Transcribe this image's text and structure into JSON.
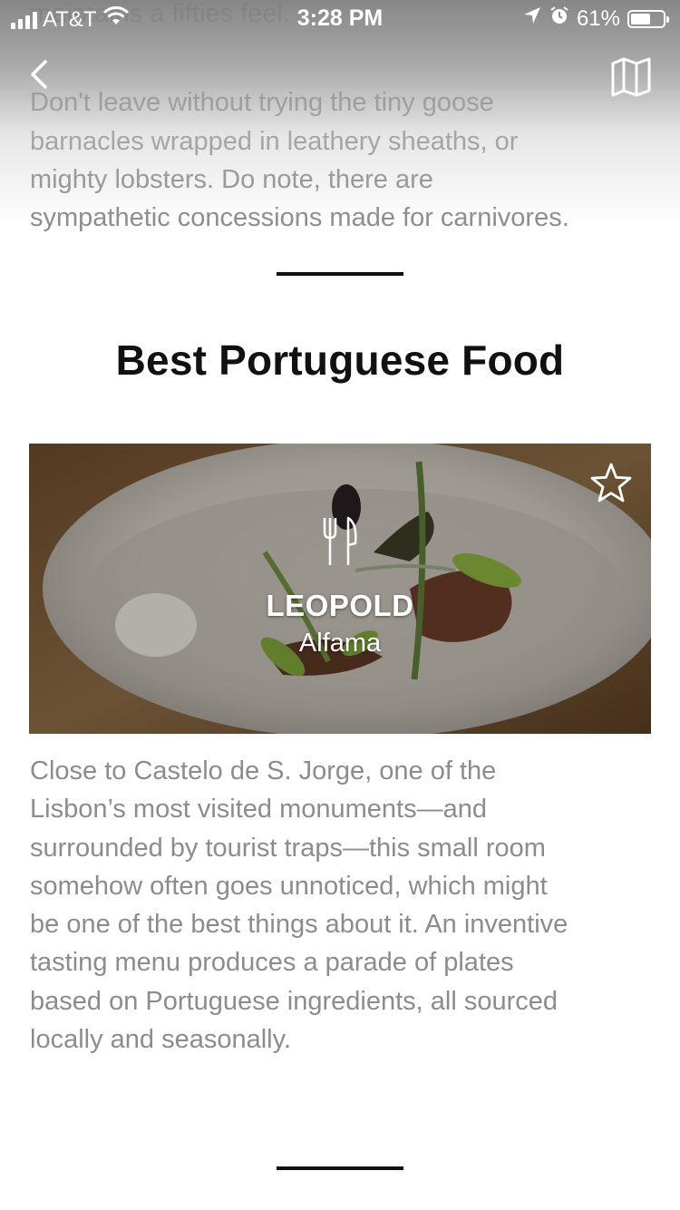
{
  "status_bar": {
    "carrier": "AT&T",
    "time": "3:28 PM",
    "battery_percent": "61%",
    "battery_level": 0.61,
    "signal_bars": 4
  },
  "nav": {
    "back_icon": "chevron-left-icon",
    "map_icon": "map-icon"
  },
  "intro": {
    "lines": [
      "maintains a fifties feel.",
      "Don't leave without trying the tiny goose",
      "barnacles wrapped in leathery sheaths, or",
      "mighty lobsters. Do note, there are",
      "sympathetic concessions made for carnivores."
    ]
  },
  "section": {
    "title": "Best Portuguese Food"
  },
  "card": {
    "category_icon": "cutlery-icon",
    "favorite_icon": "star-icon",
    "name": "LEOPOLD",
    "area": "Alfama",
    "description_lines": [
      "Close to Castelo de S. Jorge, one of the",
      "Lisbon’s most visited monuments—and",
      "surrounded by tourist traps—this small room",
      "somehow often goes unnoticed, which might",
      "be one of the best things about it. An inventive",
      "tasting menu produces a parade of plates",
      "based on Portuguese ingredients, all sourced",
      "locally and seasonally."
    ]
  },
  "colors": {
    "body_text": "#8c8c8c",
    "title_text": "#111111",
    "divider": "#111111"
  }
}
